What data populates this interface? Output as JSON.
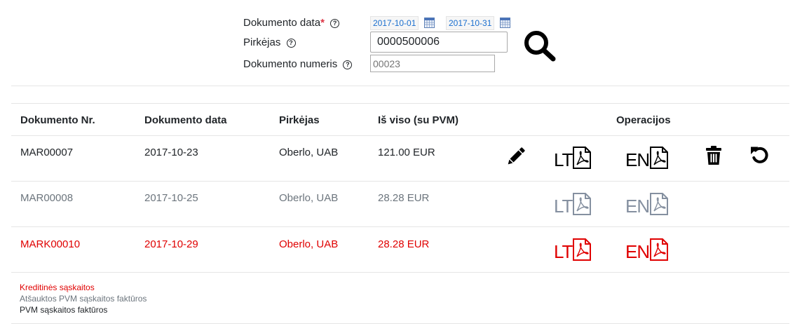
{
  "filter": {
    "date_label": "Dokumento data",
    "required_mark": "*",
    "date_from": "2017-10-01",
    "date_to": "2017-10-31",
    "buyer_label": "Pirkėjas",
    "buyer_value": "0000500006",
    "doc_number_label": "Dokumento numeris",
    "doc_number_placeholder": "00023",
    "help_glyph": "?"
  },
  "table": {
    "headers": {
      "doc_nr": "Dokumento Nr.",
      "doc_date": "Dokumento data",
      "buyer": "Pirkėjas",
      "total": "Iš viso (su PVM)",
      "operations": "Operacijos"
    },
    "rows": [
      {
        "status": "normal",
        "doc_nr": "MAR00007",
        "doc_date": "2017-10-23",
        "buyer": "Oberlo, UAB",
        "total": "121.00 EUR",
        "pdf_lt": "LT",
        "pdf_en": "EN"
      },
      {
        "status": "cancelled",
        "doc_nr": "MAR00008",
        "doc_date": "2017-10-25",
        "buyer": "Oberlo, UAB",
        "total": "28.28 EUR",
        "pdf_lt": "LT",
        "pdf_en": "EN"
      },
      {
        "status": "credit",
        "doc_nr": "MARK00010",
        "doc_date": "2017-10-29",
        "buyer": "Oberlo, UAB",
        "total": "28.28 EUR",
        "pdf_lt": "LT",
        "pdf_en": "EN"
      }
    ]
  },
  "legend": {
    "credit": "Kreditinės sąskaitos",
    "cancelled": "Atšauktos PVM sąskaitos faktūros",
    "vat": "PVM sąskaitos faktūros"
  },
  "colors": {
    "credit": "#e00000",
    "cancelled": "#6c757d",
    "normal": "#212529",
    "date_text": "#1a6fcf"
  },
  "icons": {
    "calendar": "calendar-icon",
    "search": "search-icon",
    "edit": "pencil-icon",
    "pdf": "pdf-icon",
    "delete": "trash-icon",
    "undo": "undo-icon"
  }
}
